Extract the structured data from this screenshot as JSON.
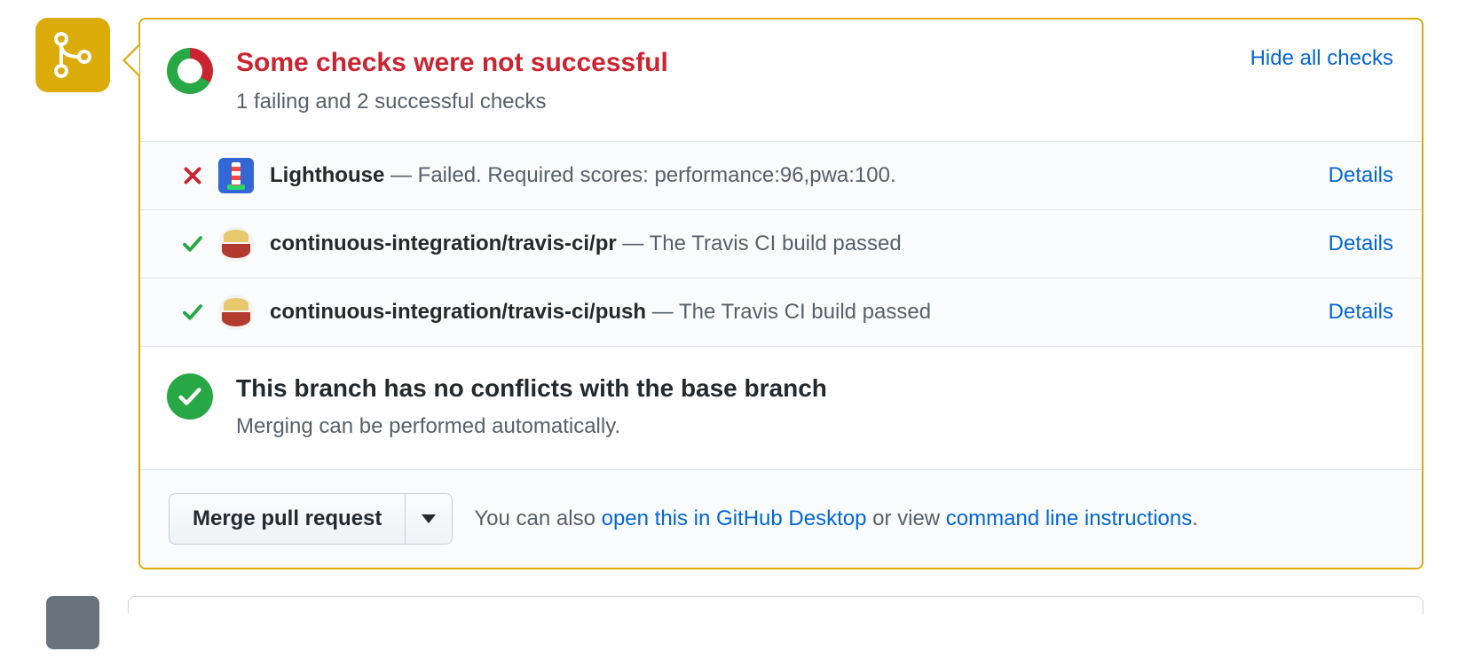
{
  "status": {
    "title": "Some checks were not successful",
    "subtitle": "1 failing and 2 successful checks",
    "hide_link": "Hide all checks"
  },
  "checks": [
    {
      "state": "fail",
      "avatar": "lighthouse",
      "context": "Lighthouse",
      "description": "Failed. Required scores: performance:96,pwa:100.",
      "details": "Details"
    },
    {
      "state": "pass",
      "avatar": "travis",
      "context": "continuous-integration/travis-ci/pr",
      "description": "The Travis CI build passed",
      "details": "Details"
    },
    {
      "state": "pass",
      "avatar": "travis",
      "context": "continuous-integration/travis-ci/push",
      "description": "The Travis CI build passed",
      "details": "Details"
    }
  ],
  "conflict": {
    "title": "This branch has no conflicts with the base branch",
    "subtitle": "Merging can be performed automatically."
  },
  "merge": {
    "button": "Merge pull request",
    "hint_prefix": "You can also ",
    "open_desktop": "open this in GitHub Desktop",
    "hint_middle": " or view ",
    "cli_instructions": "command line instructions",
    "hint_suffix": "."
  }
}
